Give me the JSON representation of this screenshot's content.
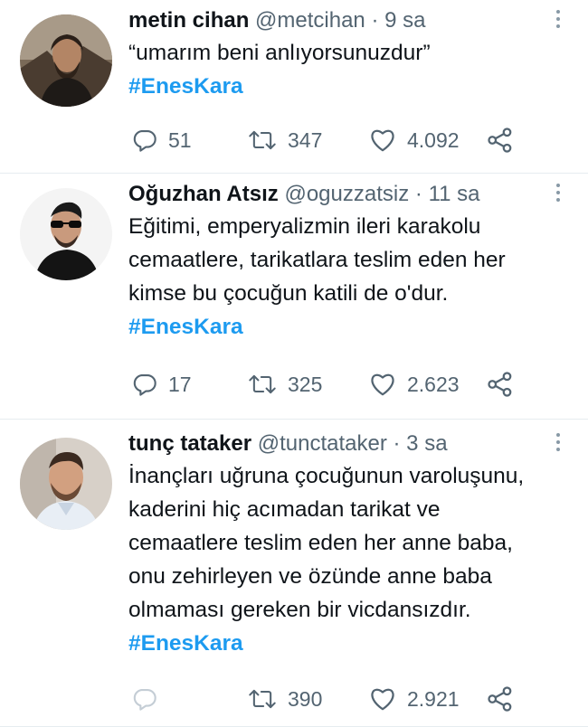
{
  "tweets": [
    {
      "name": "metin cihan",
      "handle": "@metcihan",
      "sep": "·",
      "time": "9 sa",
      "lines": [
        "“umarım beni anlıyorsunuzdur”"
      ],
      "hashtag": "#EnesKara",
      "replies": "51",
      "retweets": "347",
      "likes": "4.092",
      "reply_icon": "reply-icon",
      "retweet_icon": "retweet-icon",
      "like_icon": "heart-icon",
      "share_icon": "share-icon",
      "avatar_bg": "#6d5a48"
    },
    {
      "name": "Oğuzhan Atsız",
      "handle": "@oguzzatsiz",
      "sep": "·",
      "time": "11 sa",
      "lines": [
        "Eğitimi, emperyalizmin ileri karakolu",
        "cemaatlere, tarikatlara teslim eden her",
        "kimse bu çocuğun katili de o'dur."
      ],
      "hashtag": "#EnesKara",
      "replies": "17",
      "retweets": "325",
      "likes": "2.623",
      "avatar_bg": "#f2f2f2"
    },
    {
      "name": "tunç tataker",
      "handle": "@tunctataker",
      "sep": "·",
      "time": "3 sa",
      "lines": [
        "İnançları uğruna çocuğunun varoluşunu,",
        "kaderini hiç acımadan tarikat ve",
        "cemaatlere teslim eden her anne baba,",
        "onu zehirleyen ve özünde anne baba",
        "olmaması gereken bir vicdansızdır."
      ],
      "hashtag": "#EnesKara",
      "replies": "",
      "retweets": "390",
      "likes": "2.921",
      "avatar_bg": "#cfc6bc"
    }
  ],
  "colors": {
    "hashtag": "#1d9bf0",
    "muted": "#536471",
    "divider": "#e6ecf0"
  }
}
